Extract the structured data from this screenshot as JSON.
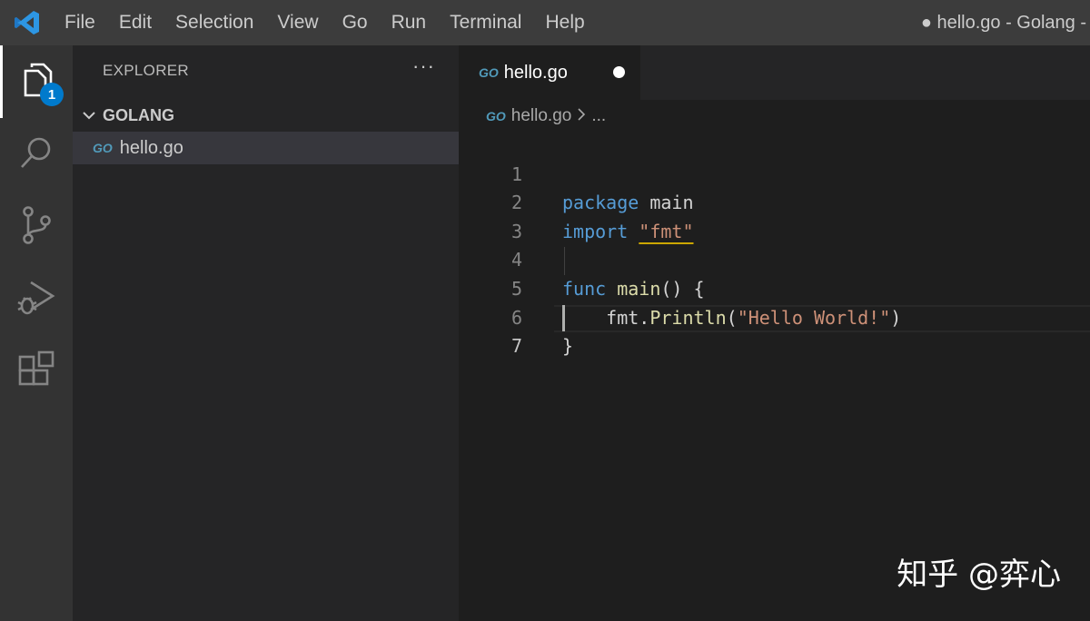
{
  "titlebar": {
    "menu": [
      "File",
      "Edit",
      "Selection",
      "View",
      "Go",
      "Run",
      "Terminal",
      "Help"
    ],
    "window_title": "● hello.go - Golang -"
  },
  "activitybar": {
    "items": [
      "explorer-icon",
      "search-icon",
      "source-control-icon",
      "run-debug-icon",
      "extensions-icon"
    ],
    "explorer_badge": "1"
  },
  "sidebar": {
    "header": "EXPLORER",
    "more": "···",
    "folder": "GOLANG",
    "files": [
      {
        "icon": "GO",
        "name": "hello.go"
      }
    ]
  },
  "editor": {
    "tab": {
      "icon": "GO",
      "label": "hello.go",
      "modified": true
    },
    "breadcrumb": {
      "icon": "GO",
      "file": "hello.go",
      "rest": "..."
    },
    "line_numbers": [
      "1",
      "2",
      "3",
      "4",
      "5",
      "6",
      "7"
    ],
    "code": {
      "l1_kw": "package",
      "l1_rest": " main",
      "l2_kw": "import",
      "l2_str": "\"fmt\"",
      "l4_kw": "func",
      "l4_fn": "main",
      "l4_rest": "() {",
      "l5_obj": "fmt.",
      "l5_fn": "Println",
      "l5_open": "(",
      "l5_str": "\"Hello World!\"",
      "l5_close": ")",
      "l6": "}"
    }
  },
  "watermark": "知乎 @弈心",
  "colors": {
    "keyword": "#569cd6",
    "function": "#dcdcaa",
    "string": "#ce9178",
    "badge": "#007acc",
    "go_icon": "#519aba"
  }
}
